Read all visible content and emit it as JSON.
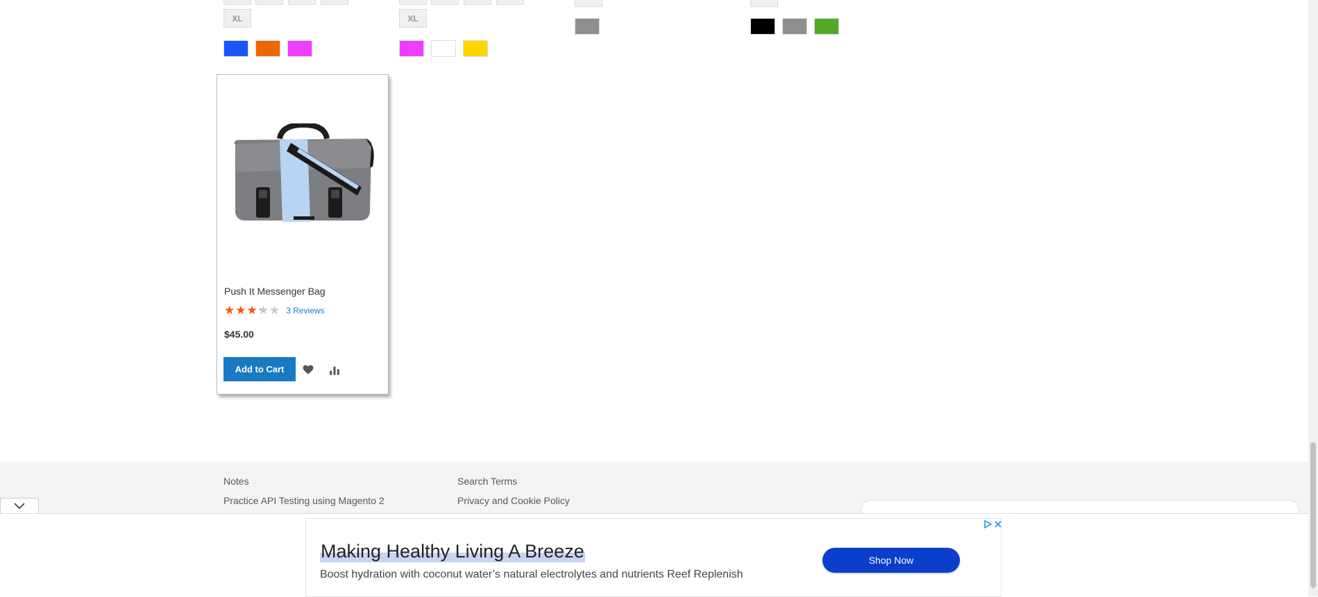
{
  "swatch_columns": [
    {
      "top_size_label": "XL",
      "colors": [
        "#1857f7",
        "#eb6703",
        "#ef3dff"
      ]
    },
    {
      "top_size_label": "XL",
      "colors": [
        "#ef3dff",
        "#ffffff",
        "#ffd500"
      ]
    },
    {
      "colors": [
        "#8f8f8f"
      ]
    },
    {
      "colors": [
        "#000000",
        "#8f8f8f",
        "#53a828"
      ]
    }
  ],
  "product": {
    "name": "Push It Messenger Bag",
    "rating_percent": 65,
    "reviews": "3 Reviews",
    "price": "$45.00",
    "add_to_cart": "Add to Cart",
    "icons": [
      "wishlist-heart-icon",
      "compare-icon"
    ]
  },
  "footer": {
    "links_col1": [
      "Notes",
      "Practice API Testing using Magento 2"
    ],
    "links_col2": [
      "Search Terms",
      "Privacy and Cookie Policy"
    ]
  },
  "ad": {
    "headline": "Making Healthy Living A Breeze",
    "description": "Boost hydration with coconut water’s natural electrolytes and nutrients Reef Replenish",
    "cta": "Shop Now"
  },
  "colors": {
    "accent_blue": "#1979c3",
    "star_orange": "#ff5501",
    "ad_button": "#0a3ecb"
  }
}
